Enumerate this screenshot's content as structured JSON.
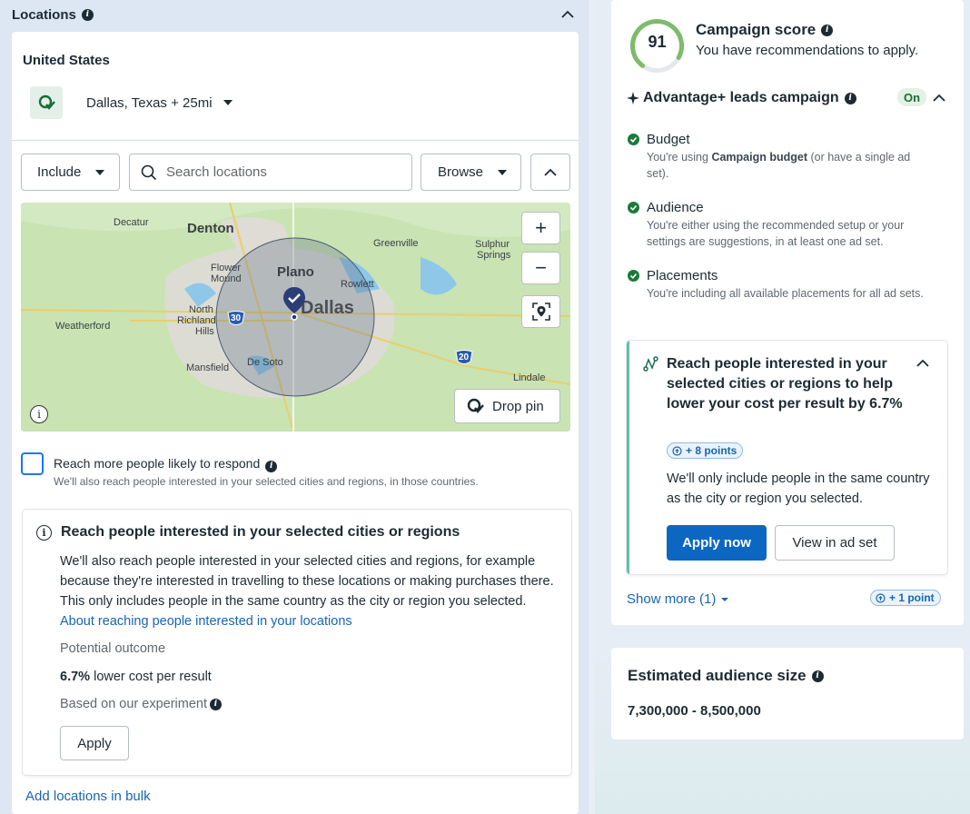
{
  "locations": {
    "title": "Locations",
    "country": "United States",
    "selected_location": "Dallas, Texas + 25mi",
    "include_label": "Include",
    "search_placeholder": "Search locations",
    "browse_label": "Browse",
    "map": {
      "labels": [
        "Decatur",
        "Denton",
        "Greenville",
        "Sulphur",
        "Springs",
        "Flower",
        "Mound",
        "Plano",
        "Rowlett",
        "North",
        "Richland",
        "Hills",
        "Dallas",
        "Weatherford",
        "Mansfield",
        "De Soto",
        "Lindale"
      ],
      "highway_labels": [
        "30",
        "20"
      ],
      "zoom_in": "+",
      "zoom_out": "−",
      "drop_pin_label": "Drop pin"
    },
    "reach_more": {
      "title": "Reach more people likely to respond",
      "subtitle": "We'll also reach people interested in your selected cities and regions, in those countries."
    },
    "reach_card": {
      "title": "Reach people interested in your selected cities or regions",
      "body": "We'll also reach people interested in your selected cities and regions, for example because they're interested in travelling to these locations or making purchases there. This only includes people in the same country as the city or region you selected.",
      "link": "About reaching people interested in your locations",
      "outcome_label": "Potential outcome",
      "outcome_value": "6.7%",
      "outcome_text": "lower cost per result",
      "outcome_note": "Based on our experiment",
      "apply_label": "Apply"
    },
    "bulk_link": "Add locations in bulk"
  },
  "campaign_score": {
    "score": "91",
    "score_fraction": 0.91,
    "title": "Campaign score",
    "subtitle": "You have recommendations to apply.",
    "advantage_title": "Advantage+ leads campaign",
    "on_label": "On",
    "checks": [
      {
        "title": "Budget",
        "sub_pre": "You're using ",
        "sub_bold": "Campaign budget",
        "sub_post": " (or have a single ad set)."
      },
      {
        "title": "Audience",
        "sub": "You're either using the recommended setup or your settings are suggestions, in at least one ad set."
      },
      {
        "title": "Placements",
        "sub": "You're including all available placements for all ad sets."
      }
    ],
    "recommendation": {
      "title": "Reach people interested in your selected cities or regions to help lower your cost per result by 6.7%",
      "points": "+ 8 points",
      "body": "We'll only include people in the same country as the city or region you selected.",
      "apply_now": "Apply now",
      "view_ad_set": "View in ad set"
    },
    "show_more": "Show more (1)",
    "more_points": "+ 1 point"
  },
  "audience": {
    "title": "Estimated audience size",
    "value": "7,300,000 - 8,500,000"
  },
  "colors": {
    "accent": "#0b67c2",
    "link": "#1666b3",
    "success": "#1a7a3a",
    "score_ring": "#7cbc6a"
  }
}
